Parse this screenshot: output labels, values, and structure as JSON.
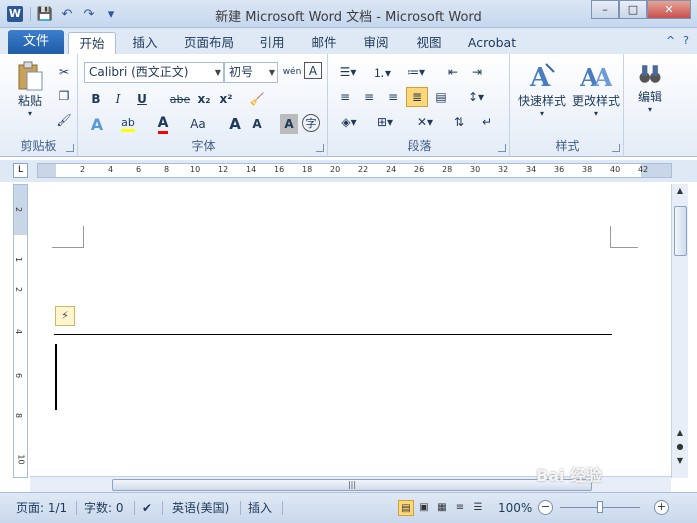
{
  "window": {
    "title": "新建 Microsoft Word 文档 - Microsoft Word",
    "app_icon": "W"
  },
  "qat": {
    "save": "💾",
    "undo": "↶",
    "redo": "↷",
    "more": "▾"
  },
  "window_buttons": {
    "minimize": "–",
    "maximize": "□",
    "close": "✕"
  },
  "tabs": {
    "file": "文件",
    "items": [
      "开始",
      "插入",
      "页面布局",
      "引用",
      "邮件",
      "审阅",
      "视图",
      "Acrobat"
    ],
    "active": "开始"
  },
  "help": {
    "caret": "^",
    "question": "?"
  },
  "ribbon": {
    "clipboard": {
      "label": "剪贴板",
      "paste": "粘贴"
    },
    "font": {
      "label": "字体",
      "font_name": "Calibri (西文正文)",
      "font_size": "初号",
      "bold": "B",
      "italic": "I",
      "underline": "U",
      "strike": "abe",
      "subscript": "x₂",
      "superscript": "x²",
      "change_case": "Aa",
      "grow": "A",
      "shrink": "A",
      "char_shade": "A",
      "enclose": "字",
      "wen": "wén",
      "border_char": "A"
    },
    "paragraph": {
      "label": "段落"
    },
    "styles": {
      "label": "样式",
      "quick": "快速样式",
      "change": "更改样式"
    },
    "editing": {
      "label": "编辑"
    }
  },
  "ruler": {
    "corner": "L",
    "ticks": [
      "2",
      "4",
      "6",
      "8",
      "10",
      "12",
      "14",
      "16",
      "18",
      "20",
      "22",
      "24",
      "26",
      "28",
      "30",
      "32",
      "34",
      "36",
      "38",
      "40",
      "42"
    ],
    "vticks": [
      "2",
      "1",
      "2",
      "4",
      "6",
      "8",
      "10"
    ]
  },
  "document": {
    "smart_tag": "⚡"
  },
  "statusbar": {
    "page": "页面: 1/1",
    "words": "字数: 0",
    "language": "英语(美国)",
    "mode": "插入",
    "zoom": "100%",
    "zoom_minus": "−",
    "zoom_plus": "+"
  },
  "watermark": "Bai 经验"
}
